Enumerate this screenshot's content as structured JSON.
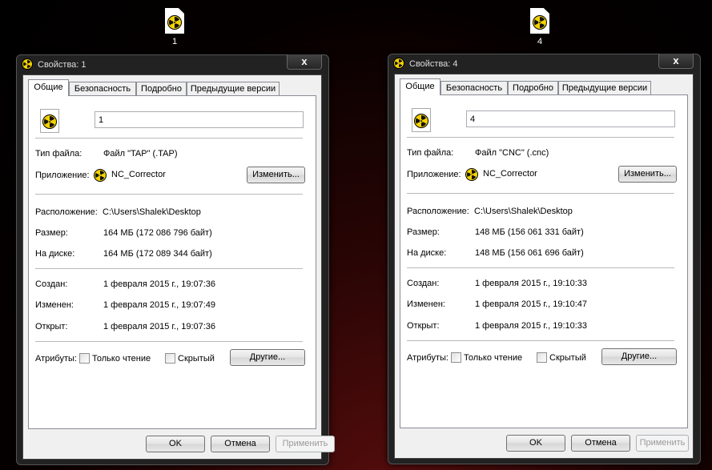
{
  "desktop_icons": [
    {
      "label": "1",
      "icon": "radiation-file-icon"
    },
    {
      "label": "4",
      "icon": "radiation-file-icon"
    }
  ],
  "windows": [
    {
      "title": "Свойства: 1",
      "close_label": "x",
      "tabs": [
        "Общие",
        "Безопасность",
        "Подробно",
        "Предыдущие версии"
      ],
      "active_tab": "Общие",
      "file_name": "1",
      "file_type_label": "Тип файла:",
      "file_type_value": "Файл \"TAP\" (.TAP)",
      "app_label": "Приложение:",
      "app_value": "NC_Corrector",
      "change_button": "Изменить...",
      "location_label": "Расположение:",
      "location_value": "C:\\Users\\Shalek\\Desktop",
      "size_label": "Размер:",
      "size_value": "164 МБ (172 086 796 байт)",
      "disk_label": "На диске:",
      "disk_value": "164 МБ (172 089 344 байт)",
      "created_label": "Создан:",
      "created_value": "1 февраля 2015 г., 19:07:36",
      "modified_label": "Изменен:",
      "modified_value": "1 февраля 2015 г., 19:07:49",
      "opened_label": "Открыт:",
      "opened_value": "1 февраля 2015 г., 19:07:36",
      "attributes_label": "Атрибуты:",
      "readonly_label": "Только чтение",
      "hidden_label": "Скрытый",
      "other_button": "Другие...",
      "ok_button": "OK",
      "cancel_button": "Отмена",
      "apply_button": "Применить"
    },
    {
      "title": "Свойства: 4",
      "close_label": "x",
      "tabs": [
        "Общие",
        "Безопасность",
        "Подробно",
        "Предыдущие версии"
      ],
      "active_tab": "Общие",
      "file_name": "4",
      "file_type_label": "Тип файла:",
      "file_type_value": "Файл \"CNC\" (.cnc)",
      "app_label": "Приложение:",
      "app_value": "NC_Corrector",
      "change_button": "Изменить...",
      "location_label": "Расположение:",
      "location_value": "C:\\Users\\Shalek\\Desktop",
      "size_label": "Размер:",
      "size_value": "148 МБ (156 061 331 байт)",
      "disk_label": "На диске:",
      "disk_value": "148 МБ (156 061 696 байт)",
      "created_label": "Создан:",
      "created_value": "1 февраля 2015 г., 19:10:33",
      "modified_label": "Изменен:",
      "modified_value": "1 февраля 2015 г., 19:10:47",
      "opened_label": "Открыт:",
      "opened_value": "1 февраля 2015 г., 19:10:33",
      "attributes_label": "Атрибуты:",
      "readonly_label": "Только чтение",
      "hidden_label": "Скрытый",
      "other_button": "Другие...",
      "ok_button": "OK",
      "cancel_button": "Отмена",
      "apply_button": "Применить"
    }
  ],
  "colors": {
    "radiation_yellow": "#f2d100",
    "background_red": "#5a0d0d"
  }
}
